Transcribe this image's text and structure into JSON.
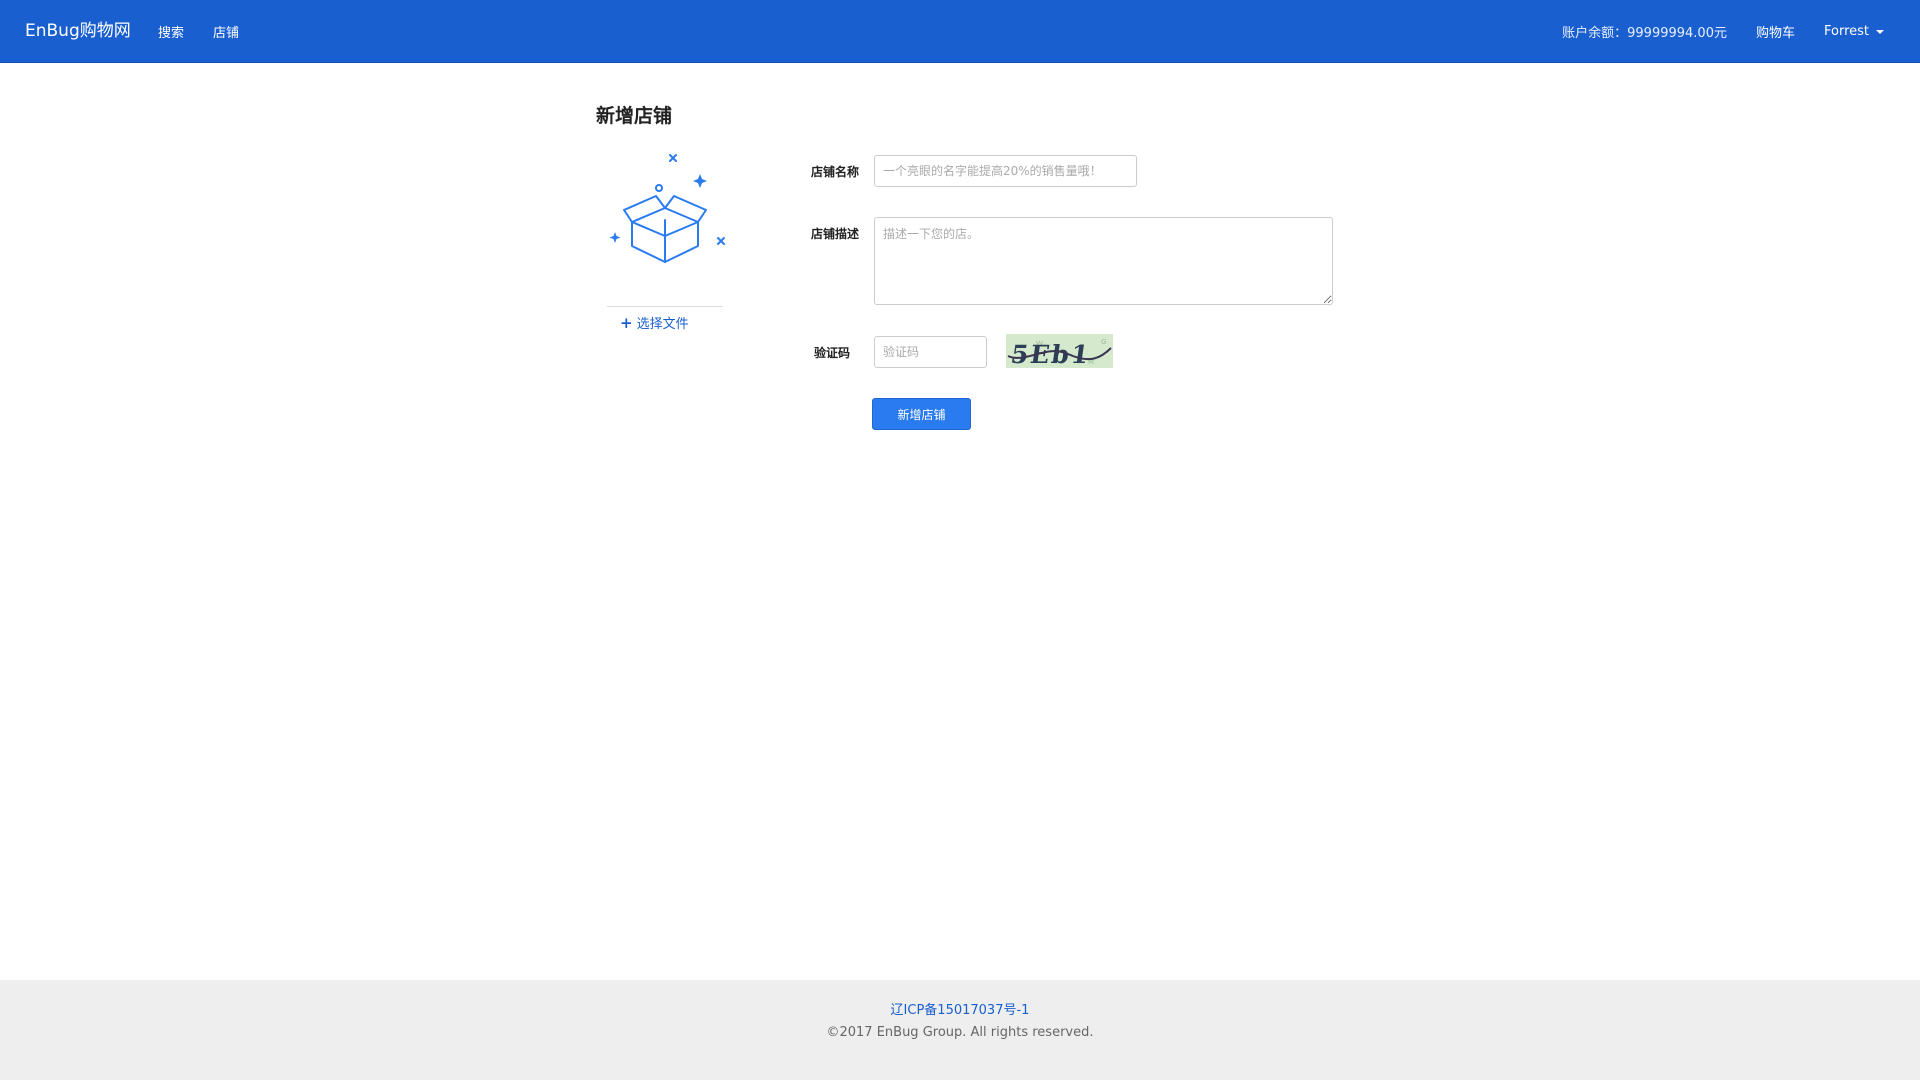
{
  "navbar": {
    "brand": "EnBug购物网",
    "links": [
      {
        "label": "搜索"
      },
      {
        "label": "店铺"
      }
    ],
    "balance": "账户余额：99999994.00元",
    "cart": "购物车",
    "user": "Forrest"
  },
  "main": {
    "title": "新增店铺",
    "upload": {
      "choose_file": "选择文件",
      "icon": "open-box-icon"
    },
    "form": {
      "name": {
        "label": "店铺名称",
        "placeholder": "一个亮眼的名字能提高20%的销售量哦！",
        "value": ""
      },
      "description": {
        "label": "店铺描述",
        "placeholder": "描述一下您的店。",
        "value": ""
      },
      "captcha": {
        "label": "验证码",
        "placeholder": "验证码",
        "value": "",
        "image_text": "5Eb1"
      },
      "submit_label": "新增店铺"
    }
  },
  "footer": {
    "icp": "辽ICP备15017037号-1",
    "copyright": "©2017 EnBug Group. All rights reserved."
  },
  "colors": {
    "navbar_bg": "#1a5fd0",
    "primary_button": "#2a7bef",
    "link": "#1a5fd0",
    "footer_bg": "#eeeeee"
  }
}
